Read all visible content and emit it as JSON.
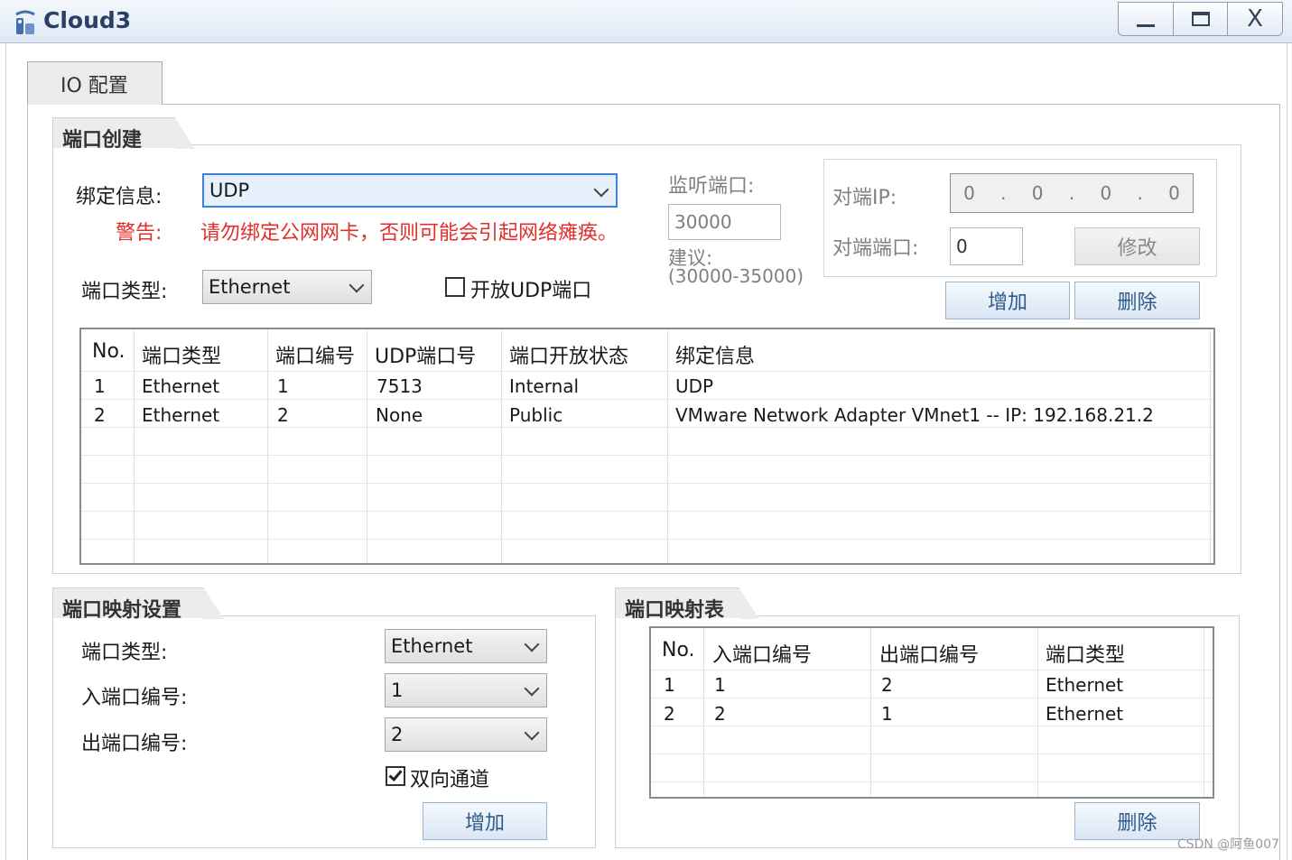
{
  "window": {
    "title": "Cloud3",
    "minimize_icon": "minimize-icon",
    "maximize_icon": "maximize-icon",
    "close_glyph": "X"
  },
  "tabs": [
    {
      "label": "IO 配置",
      "active": true
    }
  ],
  "port_create": {
    "title": "端口创建",
    "binding_label": "绑定信息:",
    "binding_value": "UDP",
    "warning_label": "警告:",
    "warning_text": "请勿绑定公网网卡，否则可能会引起网络瘫痪。",
    "port_type_label": "端口类型:",
    "port_type_value": "Ethernet",
    "open_udp_label": "开放UDP端口",
    "open_udp_checked": false,
    "listen_port_label": "监听端口:",
    "listen_port_value": "30000",
    "suggest_label": "建议:",
    "suggest_range": "(30000-35000)",
    "peer_ip_label": "对端IP:",
    "peer_ip_octets": [
      "0",
      "0",
      "0",
      "0"
    ],
    "peer_ip_dot": ".",
    "peer_port_label": "对端端口:",
    "peer_port_value": "0",
    "modify_button": "修改",
    "add_button": "增加",
    "delete_button": "删除",
    "table": {
      "columns": [
        "No.",
        "端口类型",
        "端口编号",
        "UDP端口号",
        "端口开放状态",
        "绑定信息"
      ],
      "rows": [
        [
          "1",
          "Ethernet",
          "1",
          "7513",
          "Internal",
          "UDP"
        ],
        [
          "2",
          "Ethernet",
          "2",
          "None",
          "Public",
          "VMware Network Adapter VMnet1 -- IP: 192.168.21.2"
        ]
      ]
    }
  },
  "mapping_settings": {
    "title": "端口映射设置",
    "port_type_label": "端口类型:",
    "port_type_value": "Ethernet",
    "in_port_label": "入端口编号:",
    "in_port_value": "1",
    "out_port_label": "出端口编号:",
    "out_port_value": "2",
    "bidirectional_label": "双向通道",
    "bidirectional_checked": true,
    "add_button": "增加"
  },
  "mapping_table": {
    "title": "端口映射表",
    "columns": [
      "No.",
      "入端口编号",
      "出端口编号",
      "端口类型"
    ],
    "rows": [
      [
        "1",
        "1",
        "2",
        "Ethernet"
      ],
      [
        "2",
        "2",
        "1",
        "Ethernet"
      ]
    ],
    "delete_button": "删除"
  },
  "watermark": "CSDN @阿鱼007",
  "colors": {
    "warning": "#e0302b",
    "button_text": "#2f5a8a",
    "title_text": "#2a3f66"
  }
}
